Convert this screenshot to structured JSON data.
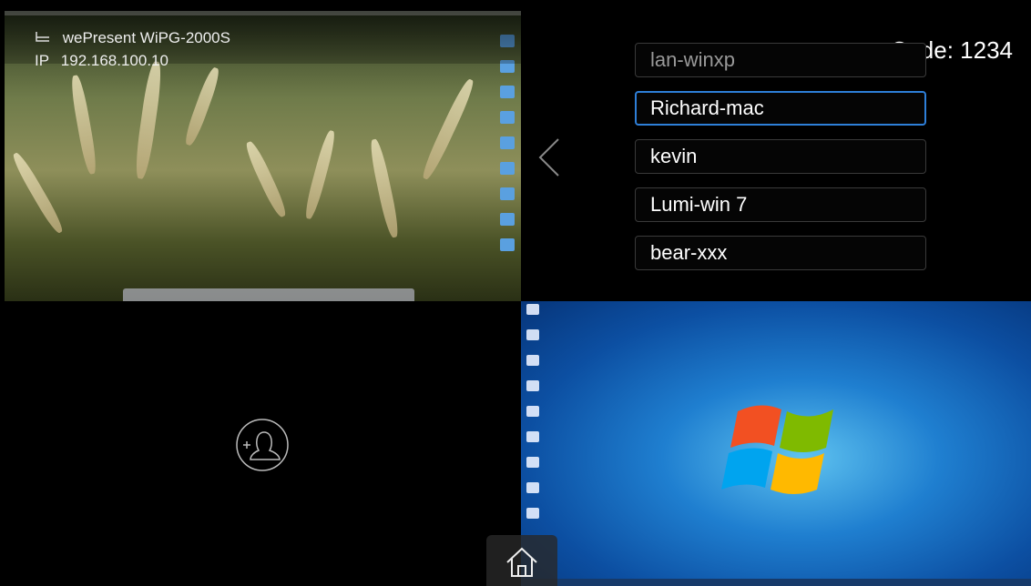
{
  "device": {
    "name": "wePresent WiPG-2000S",
    "ip_label": "IP",
    "ip": "192.168.100.10",
    "code_text": "Code: 1234"
  },
  "clients": [
    {
      "name": "lan-winxp",
      "state": "dim"
    },
    {
      "name": "Richard-mac",
      "state": "selected"
    },
    {
      "name": "kevin",
      "state": "normal"
    },
    {
      "name": "Lumi-win 7",
      "state": "normal"
    },
    {
      "name": "bear-xxx",
      "state": "normal"
    }
  ],
  "icons": {
    "router": "router-icon",
    "back": "chevron-left-icon",
    "add_user": "add-user-icon",
    "home": "home-icon",
    "windows_logo": "windows-logo-icon"
  },
  "colors": {
    "selected_border": "#2e7fd8",
    "item_border": "#3a3a3a"
  }
}
